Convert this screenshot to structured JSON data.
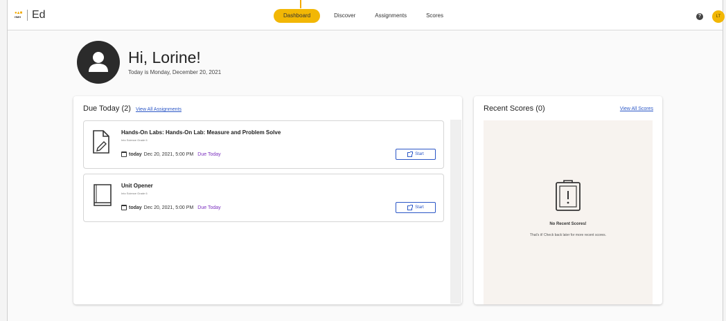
{
  "app": {
    "logo_text": "HMH",
    "name": "Ed"
  },
  "nav": {
    "items": [
      "Dashboard",
      "Discover",
      "Assignments",
      "Scores"
    ],
    "active": "Dashboard"
  },
  "header": {
    "help_icon": "help-icon",
    "user_initials": "LT"
  },
  "hero": {
    "greeting": "Hi, Lorine!",
    "date_line": "Today is Monday, December 20, 2021"
  },
  "due": {
    "title": "Due Today (2)",
    "view_all": "View All Assignments",
    "items": [
      {
        "title": "Hands-On Labs: Hands-On Lab: Measure and Problem Solve",
        "subtitle": "Into Science Grade 6",
        "today": "today",
        "datetime": "Dec 20, 2021, 5:00 PM",
        "status": "Due Today",
        "action": "Start",
        "icon": "document-pencil-icon"
      },
      {
        "title": "Unit Opener",
        "subtitle": "Into Science Grade 6",
        "today": "today",
        "datetime": "Dec 20, 2021, 5:00 PM",
        "status": "Due Today",
        "action": "Start",
        "icon": "book-icon"
      }
    ]
  },
  "scores": {
    "title": "Recent Scores (0)",
    "view_all": "View All Scores",
    "empty_title": "No Recent Scores!",
    "empty_sub": "That's it! Check back later for more recent scores."
  },
  "colors": {
    "accent": "#f2b705",
    "link": "#2a56c6",
    "due_status": "#7b2fbf"
  }
}
